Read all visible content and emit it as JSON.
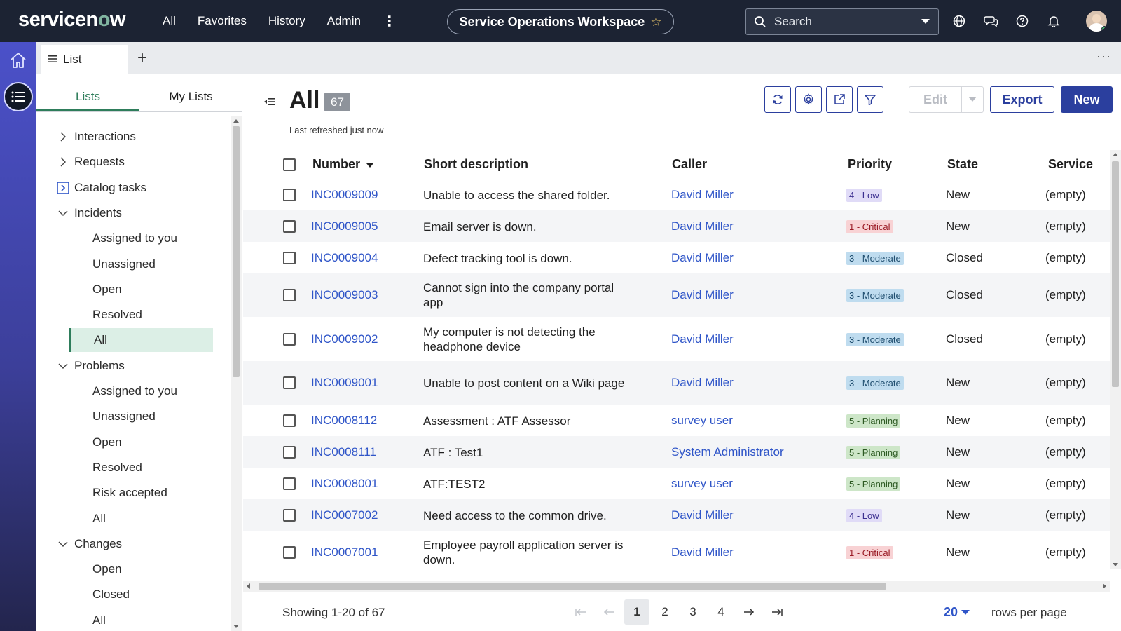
{
  "topbar": {
    "logo_text_a": "servicen",
    "logo_text_o": "o",
    "logo_text_b": "w",
    "nav": [
      "All",
      "Favorites",
      "History",
      "Admin"
    ],
    "more": "⋮",
    "workspace_title": "Service Operations Workspace",
    "search_placeholder": "Search"
  },
  "tabstrip": {
    "tab_label": "List",
    "add": "+",
    "more": "···"
  },
  "sidebar": {
    "tabs": [
      "Lists",
      "My Lists"
    ],
    "tree": [
      {
        "label": "Interactions",
        "level": 0,
        "chevron": "right"
      },
      {
        "label": "Requests",
        "level": 0,
        "chevron": "right"
      },
      {
        "label": "Catalog tasks",
        "level": 0,
        "chevron": "box"
      },
      {
        "label": "Incidents",
        "level": 0,
        "chevron": "down"
      },
      {
        "label": "Assigned to you",
        "level": 1
      },
      {
        "label": "Unassigned",
        "level": 1
      },
      {
        "label": "Open",
        "level": 1
      },
      {
        "label": "Resolved",
        "level": 1
      },
      {
        "label": "All",
        "level": 1,
        "selected": true
      },
      {
        "label": "Problems",
        "level": 0,
        "chevron": "down"
      },
      {
        "label": "Assigned to you",
        "level": 1
      },
      {
        "label": "Unassigned",
        "level": 1
      },
      {
        "label": "Open",
        "level": 1
      },
      {
        "label": "Resolved",
        "level": 1
      },
      {
        "label": "Risk accepted",
        "level": 1
      },
      {
        "label": "All",
        "level": 1
      },
      {
        "label": "Changes",
        "level": 0,
        "chevron": "down"
      },
      {
        "label": "Open",
        "level": 1
      },
      {
        "label": "Closed",
        "level": 1
      },
      {
        "label": "All",
        "level": 1
      }
    ]
  },
  "main": {
    "title": "All",
    "count": "67",
    "refreshed": "Last refreshed just now",
    "edit_label": "Edit",
    "export_label": "Export",
    "new_label": "New"
  },
  "table": {
    "columns": [
      "Number",
      "Short description",
      "Caller",
      "Priority",
      "State",
      "Service"
    ],
    "rows": [
      {
        "number": "INC0009009",
        "desc": "Unable to access the shared folder.",
        "caller": "David Miller",
        "priority": "4 - Low",
        "pclass": "p-low",
        "state": "New",
        "service": "(empty)"
      },
      {
        "number": "INC0009005",
        "desc": "Email server is down.",
        "caller": "David Miller",
        "priority": "1 - Critical",
        "pclass": "p-crit",
        "state": "New",
        "service": "(empty)"
      },
      {
        "number": "INC0009004",
        "desc": "Defect tracking tool is down.",
        "caller": "David Miller",
        "priority": "3 - Moderate",
        "pclass": "p-mod",
        "state": "Closed",
        "service": "(empty)"
      },
      {
        "number": "INC0009003",
        "desc": "Cannot sign into the company portal app",
        "caller": "David Miller",
        "priority": "3 - Moderate",
        "pclass": "p-mod",
        "state": "Closed",
        "service": "(empty)"
      },
      {
        "number": "INC0009002",
        "desc": "My computer is not detecting the headphone device",
        "caller": "David Miller",
        "priority": "3 - Moderate",
        "pclass": "p-mod",
        "state": "Closed",
        "service": "(empty)"
      },
      {
        "number": "INC0009001",
        "desc": "Unable to post content on a Wiki page",
        "caller": "David Miller",
        "priority": "3 - Moderate",
        "pclass": "p-mod",
        "state": "New",
        "service": "(empty)"
      },
      {
        "number": "INC0008112",
        "desc": "Assessment : ATF Assessor",
        "caller": "survey user",
        "priority": "5 - Planning",
        "pclass": "p-plan",
        "state": "New",
        "service": "(empty)"
      },
      {
        "number": "INC0008111",
        "desc": "ATF : Test1",
        "caller": "System Administrator",
        "priority": "5 - Planning",
        "pclass": "p-plan",
        "state": "New",
        "service": "(empty)"
      },
      {
        "number": "INC0008001",
        "desc": "ATF:TEST2",
        "caller": "survey user",
        "priority": "5 - Planning",
        "pclass": "p-plan",
        "state": "New",
        "service": "(empty)"
      },
      {
        "number": "INC0007002",
        "desc": "Need access to the common drive.",
        "caller": "David Miller",
        "priority": "4 - Low",
        "pclass": "p-low",
        "state": "New",
        "service": "(empty)"
      },
      {
        "number": "INC0007001",
        "desc": "Employee payroll application server is down.",
        "caller": "David Miller",
        "priority": "1 - Critical",
        "pclass": "p-crit",
        "state": "New",
        "service": "(empty)"
      }
    ]
  },
  "footer": {
    "showing": "Showing 1-20 of 67",
    "pages": [
      "1",
      "2",
      "3",
      "4"
    ],
    "active_page": "1",
    "rows_per_page": "20",
    "rows_label": "rows per page"
  }
}
